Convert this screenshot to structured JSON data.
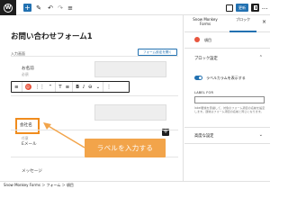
{
  "toolbar": {
    "add_icon": "+",
    "pen_icon": "✎",
    "undo_icon": "↶",
    "redo_icon": "↷",
    "list_icon": "≡",
    "publish_label": "更新",
    "accent_color": "#2271b1"
  },
  "editor": {
    "page_title": "お問い合わせフォーム1",
    "form_section_label": "入力画面",
    "form_settings_button": "フォーム設定を開く",
    "fields": [
      {
        "label": "お名前",
        "sub": "必須"
      },
      {
        "label": "会社名",
        "sub": "任意"
      },
      {
        "label": "Eメール",
        "sub": ""
      },
      {
        "label": "メッセージ",
        "sub": ""
      }
    ],
    "selected_field_color": "#f08c1d"
  },
  "block_toolbar": {
    "align_icon": "≡",
    "drag_icon": "⋮⋮",
    "mover_icon": "⌃",
    "transform_icon": "T",
    "align_text_icon": "≡",
    "bold_label": "B",
    "italic_label": "I",
    "link_icon": "⊖",
    "more_icon": "⌄",
    "options_icon": "⋮"
  },
  "annotation": {
    "text": "ラベルを入力する",
    "color": "#f2a44a"
  },
  "statusbar": {
    "breadcrumb": "Snow Monkey Forms ＞ フォーム ＞ 項目"
  },
  "sidebar": {
    "tab_form": "Snow Monkey Forms",
    "tab_block": "ブロック",
    "close_icon": "×",
    "block_name": "項目",
    "panel_block_settings": "ブロック設定",
    "toggle_label": "ラベルカラムを表示する",
    "label_for_label": "LABEL FOR",
    "help_text": "label要素を意識して、対象のフォーム項目の名前を設定します。通常はフォーム項目の名前と同じになります。",
    "panel_advanced": "高度な設定",
    "chevron_up_icon": "⌃",
    "chevron_down_icon": "⌄"
  }
}
